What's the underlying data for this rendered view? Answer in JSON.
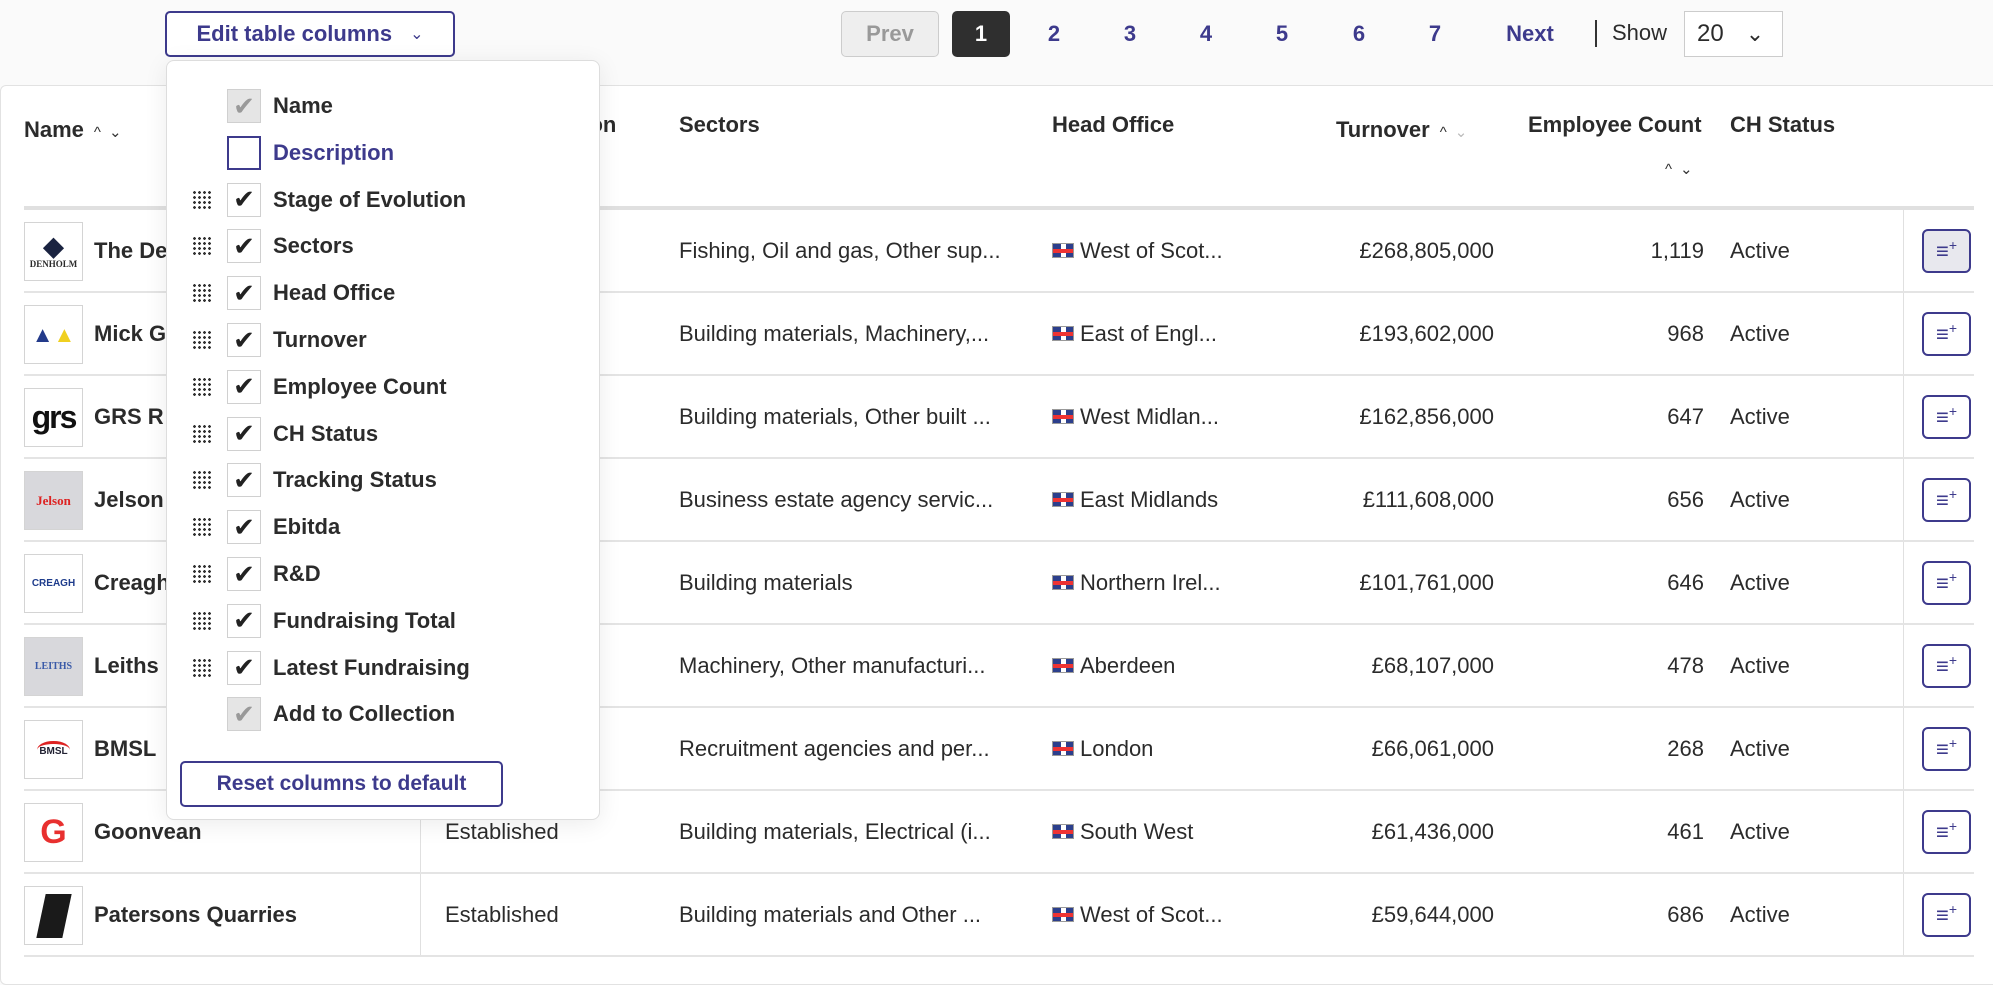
{
  "toolbar": {
    "edit_columns_label": "Edit table columns",
    "chevron_icon": "chevron-down-icon"
  },
  "pagination": {
    "prev": "Prev",
    "pages": [
      "1",
      "2",
      "3",
      "4",
      "5",
      "6",
      "7"
    ],
    "current": "1",
    "next": "Next",
    "show_label": "Show",
    "page_size": "20"
  },
  "table": {
    "headers": {
      "name": "Name",
      "stage": "Stage of Evolution",
      "stage_visible": "tion",
      "sectors": "Sectors",
      "head_office": "Head Office",
      "turnover": "Turnover",
      "employee_count": "Employee Count",
      "ch_status": "CH Status"
    },
    "rows": [
      {
        "name": "The De",
        "logo": "DENHOLM",
        "stage": "",
        "sectors": "Fishing, Oil and gas, Other sup...",
        "head_office": "West of Scot...",
        "turnover": "£268,805,000",
        "employees": "1,119",
        "status": "Active"
      },
      {
        "name": "Mick G",
        "logo": "",
        "stage": "",
        "sectors": "Building materials, Machinery,...",
        "head_office": "East of Engl...",
        "turnover": "£193,602,000",
        "employees": "968",
        "status": "Active"
      },
      {
        "name": "GRS R",
        "logo": "grs",
        "stage": "",
        "sectors": "Building materials, Other built ...",
        "head_office": "West Midlan...",
        "turnover": "£162,856,000",
        "employees": "647",
        "status": "Active"
      },
      {
        "name": "Jelson",
        "logo": "Jelson",
        "stage": "",
        "sectors": "Business estate agency servic...",
        "head_office": "East Midlands",
        "turnover": "£111,608,000",
        "employees": "656",
        "status": "Active"
      },
      {
        "name": "Creagh",
        "logo": "CREAGH",
        "stage": "",
        "sectors": "Building materials",
        "head_office": "Northern Irel...",
        "turnover": "£101,761,000",
        "employees": "646",
        "status": "Active"
      },
      {
        "name": "Leiths",
        "logo": "LEITHS",
        "stage": "",
        "sectors": "Machinery, Other manufacturi...",
        "head_office": "Aberdeen",
        "turnover": "£68,107,000",
        "employees": "478",
        "status": "Active"
      },
      {
        "name": "BMSL",
        "logo": "BMSL",
        "stage": "",
        "sectors": "Recruitment agencies and per...",
        "head_office": "London",
        "turnover": "£66,061,000",
        "employees": "268",
        "status": "Active"
      },
      {
        "name": "Goonvean",
        "logo": "G",
        "stage": "Established",
        "sectors": "Building materials, Electrical (i...",
        "head_office": "South West",
        "turnover": "£61,436,000",
        "employees": "461",
        "status": "Active"
      },
      {
        "name": "Patersons Quarries",
        "logo": "",
        "stage": "Established",
        "sectors": "Building materials and Other ...",
        "head_office": "West of Scot...",
        "turnover": "£59,644,000",
        "employees": "686",
        "status": "Active"
      }
    ]
  },
  "column_menu": {
    "options": [
      {
        "label": "Name",
        "state": "disabled-checked",
        "draggable": false
      },
      {
        "label": "Description",
        "state": "unchecked",
        "draggable": false
      },
      {
        "label": "Stage of Evolution",
        "state": "checked",
        "draggable": true
      },
      {
        "label": "Sectors",
        "state": "checked",
        "draggable": true
      },
      {
        "label": "Head Office",
        "state": "checked",
        "draggable": true
      },
      {
        "label": "Turnover",
        "state": "checked",
        "draggable": true
      },
      {
        "label": "Employee Count",
        "state": "checked",
        "draggable": true
      },
      {
        "label": "CH Status",
        "state": "checked",
        "draggable": true
      },
      {
        "label": "Tracking Status",
        "state": "checked",
        "draggable": true
      },
      {
        "label": "Ebitda",
        "state": "checked",
        "draggable": true
      },
      {
        "label": "R&D",
        "state": "checked",
        "draggable": true
      },
      {
        "label": "Fundraising Total",
        "state": "checked",
        "draggable": true
      },
      {
        "label": "Latest Fundraising",
        "state": "checked",
        "draggable": true
      },
      {
        "label": "Add to Collection",
        "state": "disabled-checked",
        "draggable": false
      }
    ],
    "reset_label": "Reset columns to default"
  },
  "colors": {
    "accent": "#3d3a8c",
    "current_page_bg": "#2f2f2f",
    "text": "#2b2b2b"
  }
}
